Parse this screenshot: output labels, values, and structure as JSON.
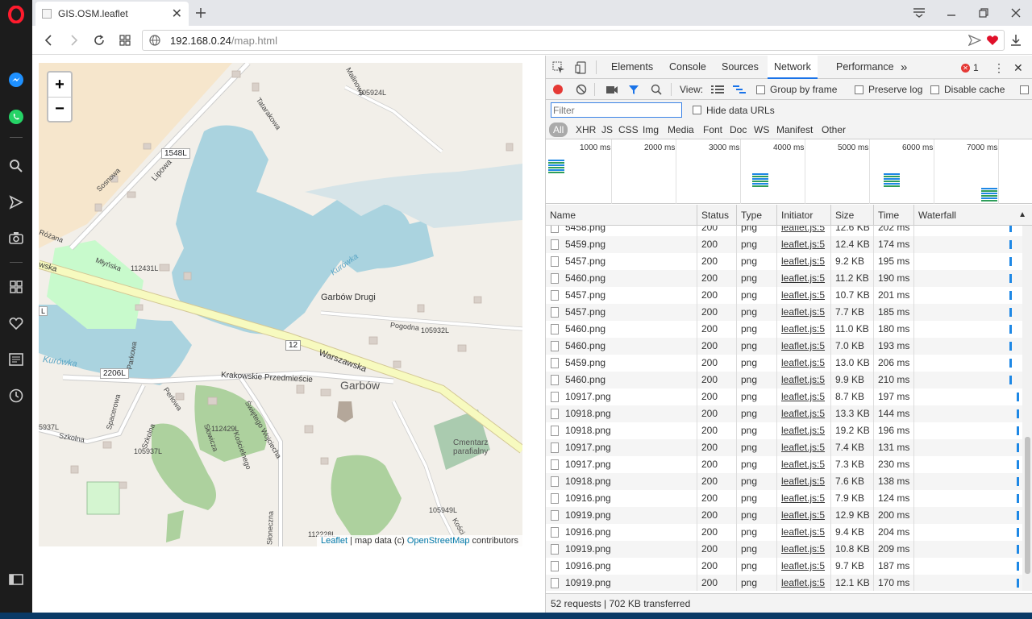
{
  "browser": {
    "tab_title": "GIS.OSM.leaflet",
    "url_host": "192.168.0.24",
    "url_path": "/map.html"
  },
  "map": {
    "zoom_in": "+",
    "zoom_out": "−",
    "labels": {
      "road_1548L": "1548L",
      "lipowa": "Lipowa",
      "sosnowa": "Sosnowa",
      "tatarakowa": "Tatarakowa",
      "malinowa": "Malinowa",
      "road_105924L": "105924L",
      "rozana": "Różana",
      "mlynska": "Młyńska",
      "road_112431L": "112431L",
      "wska": "wska",
      "l_left": "L",
      "kurowka_1": "Kurówka",
      "kurowka_2": "Kurówka",
      "garbow_drugi": "Garbów Drugi",
      "pogodna": "Pogodna",
      "road_105932L": "105932L",
      "road_12": "12",
      "warszawska": "Warszawska",
      "parkowa": "Parkowa",
      "road_2206L": "2206L",
      "krakowskie": "Krakowskie Przedmieście",
      "garbow": "Garbów",
      "perlowa": "Perłowa",
      "spacerowa": "Spacerowa",
      "road_5937L": "5937L",
      "szkolna_1": "Szkolna",
      "szkolna_2": "Szkolna",
      "road_105937L": "105937L",
      "road_112429L": "112429L",
      "slowicza": "Słowicza",
      "kosciuszki": "Kościelnego",
      "swietego": "Świętego Wojciecha",
      "cmentarz": "Cmentarz",
      "parafialny": "parafialny",
      "road_105949L": "105949L",
      "kosc": "Kości",
      "road_11222": "112228L",
      "sloneczna": "Słoneczna"
    },
    "attribution": {
      "leaflet": "Leaflet",
      "middle": " | map data (c) ",
      "osm": "OpenStreetMap",
      "end": " contributors"
    }
  },
  "devtools": {
    "tabs": [
      "Elements",
      "Console",
      "Sources",
      "Network",
      "Performance"
    ],
    "more": "»",
    "error_count": "1",
    "toolbar": {
      "view_label": "View:",
      "group_by_frame": "Group by frame",
      "preserve_log": "Preserve log",
      "disable_cache": "Disable cache"
    },
    "filter_placeholder": "Filter",
    "hide_data_urls": "Hide data URLs",
    "types": [
      "All",
      "XHR",
      "JS",
      "CSS",
      "Img",
      "Media",
      "Font",
      "Doc",
      "WS",
      "Manifest",
      "Other"
    ],
    "overview_ticks": [
      "1000 ms",
      "2000 ms",
      "3000 ms",
      "4000 ms",
      "5000 ms",
      "6000 ms",
      "7000 ms"
    ],
    "columns": [
      "Name",
      "Status",
      "Type",
      "Initiator",
      "Size",
      "Time",
      "Waterfall"
    ],
    "rows": [
      {
        "name": "5458.png",
        "status": "200",
        "type": "png",
        "initiator": "leaflet.js:5",
        "size": "12.6 KB",
        "time": "202 ms",
        "wf": 0.91
      },
      {
        "name": "5459.png",
        "status": "200",
        "type": "png",
        "initiator": "leaflet.js:5",
        "size": "12.4 KB",
        "time": "174 ms",
        "wf": 0.91
      },
      {
        "name": "5457.png",
        "status": "200",
        "type": "png",
        "initiator": "leaflet.js:5",
        "size": "9.2 KB",
        "time": "195 ms",
        "wf": 0.91
      },
      {
        "name": "5460.png",
        "status": "200",
        "type": "png",
        "initiator": "leaflet.js:5",
        "size": "11.2 KB",
        "time": "190 ms",
        "wf": 0.91
      },
      {
        "name": "5457.png",
        "status": "200",
        "type": "png",
        "initiator": "leaflet.js:5",
        "size": "10.7 KB",
        "time": "201 ms",
        "wf": 0.91
      },
      {
        "name": "5457.png",
        "status": "200",
        "type": "png",
        "initiator": "leaflet.js:5",
        "size": "7.7 KB",
        "time": "185 ms",
        "wf": 0.91
      },
      {
        "name": "5460.png",
        "status": "200",
        "type": "png",
        "initiator": "leaflet.js:5",
        "size": "11.0 KB",
        "time": "180 ms",
        "wf": 0.91
      },
      {
        "name": "5460.png",
        "status": "200",
        "type": "png",
        "initiator": "leaflet.js:5",
        "size": "7.0 KB",
        "time": "193 ms",
        "wf": 0.91
      },
      {
        "name": "5459.png",
        "status": "200",
        "type": "png",
        "initiator": "leaflet.js:5",
        "size": "13.0 KB",
        "time": "206 ms",
        "wf": 0.91
      },
      {
        "name": "5460.png",
        "status": "200",
        "type": "png",
        "initiator": "leaflet.js:5",
        "size": "9.9 KB",
        "time": "210 ms",
        "wf": 0.91
      },
      {
        "name": "10917.png",
        "status": "200",
        "type": "png",
        "initiator": "leaflet.js:5",
        "size": "8.7 KB",
        "time": "197 ms",
        "wf": 0.98
      },
      {
        "name": "10918.png",
        "status": "200",
        "type": "png",
        "initiator": "leaflet.js:5",
        "size": "13.3 KB",
        "time": "144 ms",
        "wf": 0.98
      },
      {
        "name": "10918.png",
        "status": "200",
        "type": "png",
        "initiator": "leaflet.js:5",
        "size": "19.2 KB",
        "time": "196 ms",
        "wf": 0.98
      },
      {
        "name": "10917.png",
        "status": "200",
        "type": "png",
        "initiator": "leaflet.js:5",
        "size": "7.4 KB",
        "time": "131 ms",
        "wf": 0.98
      },
      {
        "name": "10917.png",
        "status": "200",
        "type": "png",
        "initiator": "leaflet.js:5",
        "size": "7.3 KB",
        "time": "230 ms",
        "wf": 0.98
      },
      {
        "name": "10918.png",
        "status": "200",
        "type": "png",
        "initiator": "leaflet.js:5",
        "size": "7.6 KB",
        "time": "138 ms",
        "wf": 0.98
      },
      {
        "name": "10916.png",
        "status": "200",
        "type": "png",
        "initiator": "leaflet.js:5",
        "size": "7.9 KB",
        "time": "124 ms",
        "wf": 0.98
      },
      {
        "name": "10919.png",
        "status": "200",
        "type": "png",
        "initiator": "leaflet.js:5",
        "size": "12.9 KB",
        "time": "200 ms",
        "wf": 0.98
      },
      {
        "name": "10916.png",
        "status": "200",
        "type": "png",
        "initiator": "leaflet.js:5",
        "size": "9.4 KB",
        "time": "204 ms",
        "wf": 0.98
      },
      {
        "name": "10919.png",
        "status": "200",
        "type": "png",
        "initiator": "leaflet.js:5",
        "size": "10.8 KB",
        "time": "209 ms",
        "wf": 0.98
      },
      {
        "name": "10916.png",
        "status": "200",
        "type": "png",
        "initiator": "leaflet.js:5",
        "size": "9.7 KB",
        "time": "187 ms",
        "wf": 0.98
      },
      {
        "name": "10919.png",
        "status": "200",
        "type": "png",
        "initiator": "leaflet.js:5",
        "size": "12.1 KB",
        "time": "170 ms",
        "wf": 0.98
      }
    ],
    "status_bar": {
      "requests": "52 requests",
      "sep": " | ",
      "transferred": "702 KB transferred"
    }
  },
  "colors": {
    "opera_red": "#ff1b2d",
    "water": "#aad3df",
    "park": "#c8facc",
    "forest": "#add19e",
    "road_major": "#f7fabf",
    "accent": "#1a73e8"
  }
}
